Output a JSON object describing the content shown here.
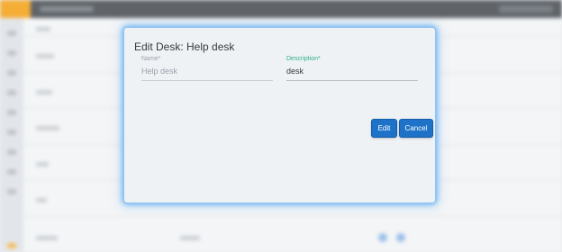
{
  "dialog": {
    "title": "Edit Desk: Help desk",
    "fields": [
      {
        "label": "Name*",
        "value": "Help desk"
      },
      {
        "label": "Description*",
        "value": "desk"
      }
    ],
    "buttons": {
      "edit": "Edit",
      "cancel": "Cancel"
    }
  },
  "colors": {
    "accent": "#1e73c9",
    "focus_label": "#2eaf86",
    "brand": "#f4a31a",
    "modal_glow": "#6fb4f2"
  }
}
